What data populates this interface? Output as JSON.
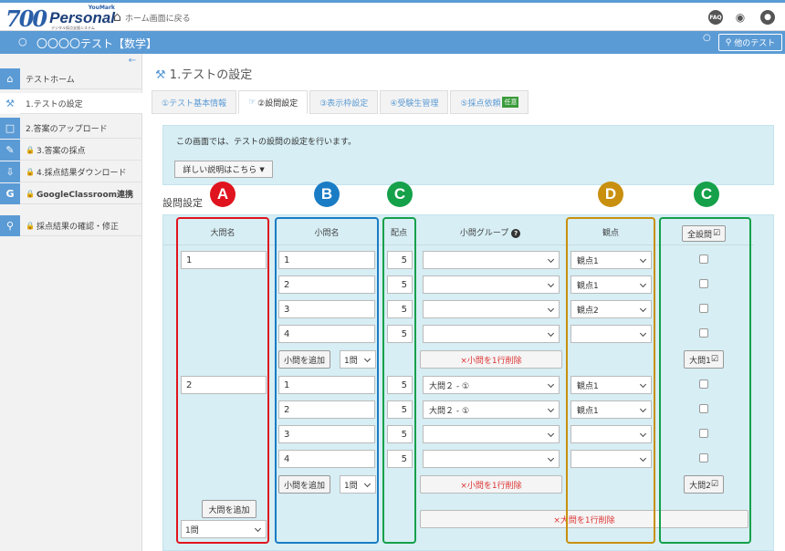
{
  "header": {
    "logo_mark": "700",
    "logo_word": "Personal",
    "logo_sup": "YouMark",
    "logo_sub": "デジタル採点支援システム",
    "home_link": "ホーム画面に戻る",
    "faq": "FAQ"
  },
  "titlebar": {
    "title": "〇〇〇〇テスト【数学】",
    "other_test": "他のテスト"
  },
  "sidebar": {
    "items": [
      {
        "label": "テストホーム",
        "icon": "home-icon",
        "locked": false
      },
      {
        "label": "1.テストの設定",
        "icon": "wrench-icon",
        "locked": false
      },
      {
        "label": "2.答案のアップロード",
        "icon": "document-icon",
        "locked": false
      },
      {
        "label": "3.答案の採点",
        "icon": "edit-icon",
        "locked": true
      },
      {
        "label": "4.採点結果ダウンロード",
        "icon": "download-icon",
        "locked": true
      },
      {
        "label": "GoogleClassroom連携",
        "icon": "google-icon",
        "locked": true
      },
      {
        "label": "採点結果の確認・修正",
        "icon": "search-icon",
        "locked": true
      }
    ]
  },
  "main": {
    "page_title": "1.テストの設定",
    "tabs": [
      {
        "label": "①テスト基本情報"
      },
      {
        "label": "②設問設定"
      },
      {
        "label": "③表示枠設定"
      },
      {
        "label": "④受験生管理"
      },
      {
        "label": "⑤採点依頼",
        "badge": "任意"
      }
    ],
    "info_text": "この画面では、テストの設問の設定を行います。",
    "detail_button": "詳しい説明はこちら",
    "section_title": "設問設定"
  },
  "table": {
    "headers": {
      "major": "大問名",
      "minor": "小問名",
      "points": "配点",
      "group": "小問グループ",
      "viewpoint": "観点",
      "all_set": "全設問"
    },
    "questions": [
      {
        "name": "1",
        "group_button": "大問1",
        "subs": [
          {
            "name": "1",
            "points": "5",
            "group": "",
            "viewpoint": "観点1"
          },
          {
            "name": "2",
            "points": "5",
            "group": "",
            "viewpoint": "観点1"
          },
          {
            "name": "3",
            "points": "5",
            "group": "",
            "viewpoint": "観点2"
          },
          {
            "name": "4",
            "points": "5",
            "group": "",
            "viewpoint": ""
          }
        ]
      },
      {
        "name": "2",
        "group_button": "大問2",
        "subs": [
          {
            "name": "1",
            "points": "5",
            "group": "大問２ - ①",
            "viewpoint": "観点1"
          },
          {
            "name": "2",
            "points": "5",
            "group": "大問２ - ①",
            "viewpoint": "観点1"
          },
          {
            "name": "3",
            "points": "5",
            "group": "",
            "viewpoint": ""
          },
          {
            "name": "4",
            "points": "5",
            "group": "",
            "viewpoint": ""
          }
        ]
      }
    ],
    "add_sub_button": "小問を追加",
    "sub_count": "1問",
    "delete_sub_button": "×小問を1行削除",
    "add_major_button": "大問を追加",
    "major_count": "1問",
    "delete_major_button": "×大問を1行削除"
  },
  "annotations": [
    {
      "letter": "A",
      "color": "#e0141e"
    },
    {
      "letter": "B",
      "color": "#1a7cc4"
    },
    {
      "letter": "C",
      "color": "#15a04a"
    },
    {
      "letter": "D",
      "color": "#c8900e"
    },
    {
      "letter": "C",
      "color": "#15a04a"
    }
  ]
}
